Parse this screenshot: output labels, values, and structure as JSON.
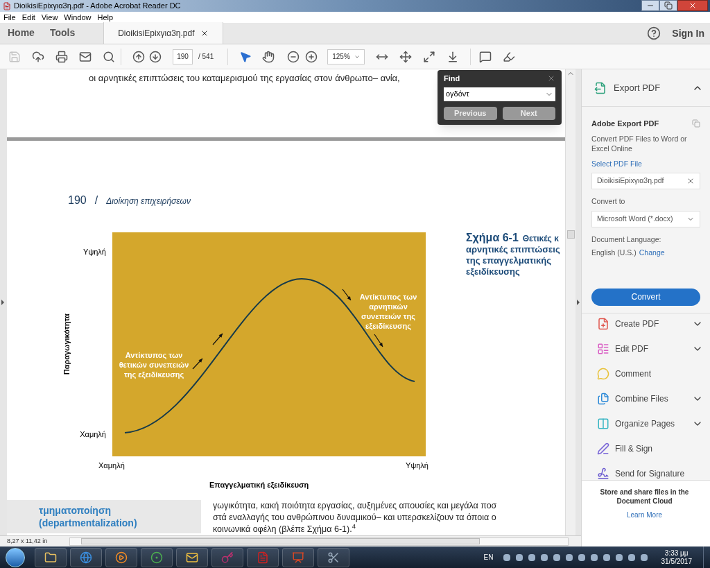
{
  "window": {
    "title": "DioikisiEpixγια3η.pdf - Adobe Acrobat Reader DC"
  },
  "menu": [
    "File",
    "Edit",
    "View",
    "Window",
    "Help"
  ],
  "tabs": [
    {
      "label": "Home",
      "kind": "nav",
      "selected": false
    },
    {
      "label": "Tools",
      "kind": "nav",
      "selected": false
    },
    {
      "label": "DioikisiEpixγια3η.pdf",
      "kind": "document",
      "selected": true
    }
  ],
  "sign_in": "Sign In",
  "toolbar": {
    "file_tools": [
      {
        "kind": "save",
        "disabled": true
      },
      {
        "kind": "upload",
        "disabled": false
      },
      {
        "kind": "print",
        "disabled": false
      },
      {
        "kind": "mail",
        "disabled": false
      },
      {
        "kind": "search",
        "disabled": false
      }
    ],
    "page": "190",
    "page_total": "/ 541",
    "pointer_tools": [
      {
        "kind": "select",
        "selected": true
      },
      {
        "kind": "hand",
        "selected": false
      }
    ],
    "zoom": "125%"
  },
  "find": {
    "title": "Find",
    "query": "ογδόντ",
    "buttons": [
      "Previous",
      "Next"
    ]
  },
  "document": {
    "top_line": "οι αρνητικές επιπτώσεις του καταμερισμού της εργασίας στον άνθρωπο– ανία,",
    "page_number": "190",
    "separator": "/",
    "running_head": "Διοίκηση επιχειρήσεων",
    "figure": {
      "y_title": "Παραγωγικότητα",
      "y_high": "Υψηλή",
      "y_low": "Χαμηλή",
      "x_low": "Χαμηλή",
      "x_high": "Υψηλή",
      "x_title": "Επαγγελματική εξειδίκευση",
      "annotations": [
        {
          "lines": [
            "Αντίκτυπος των",
            "θετικών συνεπειών",
            "της εξειδίκευσης"
          ]
        },
        {
          "lines": [
            "Αντίκτυπος των",
            "αρνητικών",
            "συνεπειών της",
            "εξειδίκευσης"
          ]
        }
      ]
    },
    "caption": {
      "label": "Σχήμα 6-1",
      "lines": [
        "Θετικές κ",
        "αρνητικές επιπτώσεις",
        "της επαγγελματικής",
        "εξειδίκευσης"
      ]
    },
    "margin_term": [
      "τμηματοποίηση",
      "(departmentalization)"
    ],
    "body_lines": [
      "γωγικότητα, κακή ποιότητα εργασίας, αυξημένες απουσίες και μεγάλα ποσ",
      "στά εναλλαγής του ανθρώπινου δυναμικού– και υπερσκελίζουν τα όποια ο",
      "κοινωνικά οφέλη (βλέπε Σχήμα 6-1).$^{4}$"
    ]
  },
  "status": "8,27 x 11,42 in",
  "pane": {
    "export": {
      "title": "Export PDF",
      "expanded": true,
      "heading": "Adobe Export PDF",
      "description": "Convert PDF Files to Word or Excel Online",
      "select_label": "Select PDF File",
      "file": "DioikisiEpixγια3η.pdf",
      "convert_to_label": "Convert to",
      "format": "Microsoft Word (*.docx)",
      "language_label": "Document Language:",
      "language": "English (U.S.)",
      "change": "Change",
      "button": "Convert"
    },
    "tools": [
      {
        "label": "Create PDF",
        "kind": "create",
        "color": "#e0574f",
        "expandable": true
      },
      {
        "label": "Edit PDF",
        "kind": "edit",
        "color": "#d95fc4",
        "expandable": true
      },
      {
        "label": "Comment",
        "kind": "comment",
        "color": "#e8c23a",
        "expandable": false
      },
      {
        "label": "Combine Files",
        "kind": "combine",
        "color": "#2d8ad8",
        "expandable": true
      },
      {
        "label": "Organize Pages",
        "kind": "organize",
        "color": "#3ab6c4",
        "expandable": true
      },
      {
        "label": "Fill & Sign",
        "kind": "sign",
        "color": "#7b68d8",
        "expandable": false
      },
      {
        "label": "Send for Signature",
        "kind": "send",
        "color": "#6a5ad0",
        "expandable": false
      }
    ],
    "footer": "Store and share files in the Document Cloud",
    "learn_more": "Learn More"
  },
  "taskbar": {
    "apps": [
      {
        "kind": "explorer"
      },
      {
        "kind": "browser"
      },
      {
        "kind": "media"
      },
      {
        "kind": "chrome"
      },
      {
        "kind": "mail"
      },
      {
        "kind": "access"
      },
      {
        "kind": "acrobat"
      },
      {
        "kind": "slides"
      },
      {
        "kind": "snip"
      }
    ],
    "language": "EN",
    "time": "3:33 μμ",
    "date": "31/5/2017"
  }
}
